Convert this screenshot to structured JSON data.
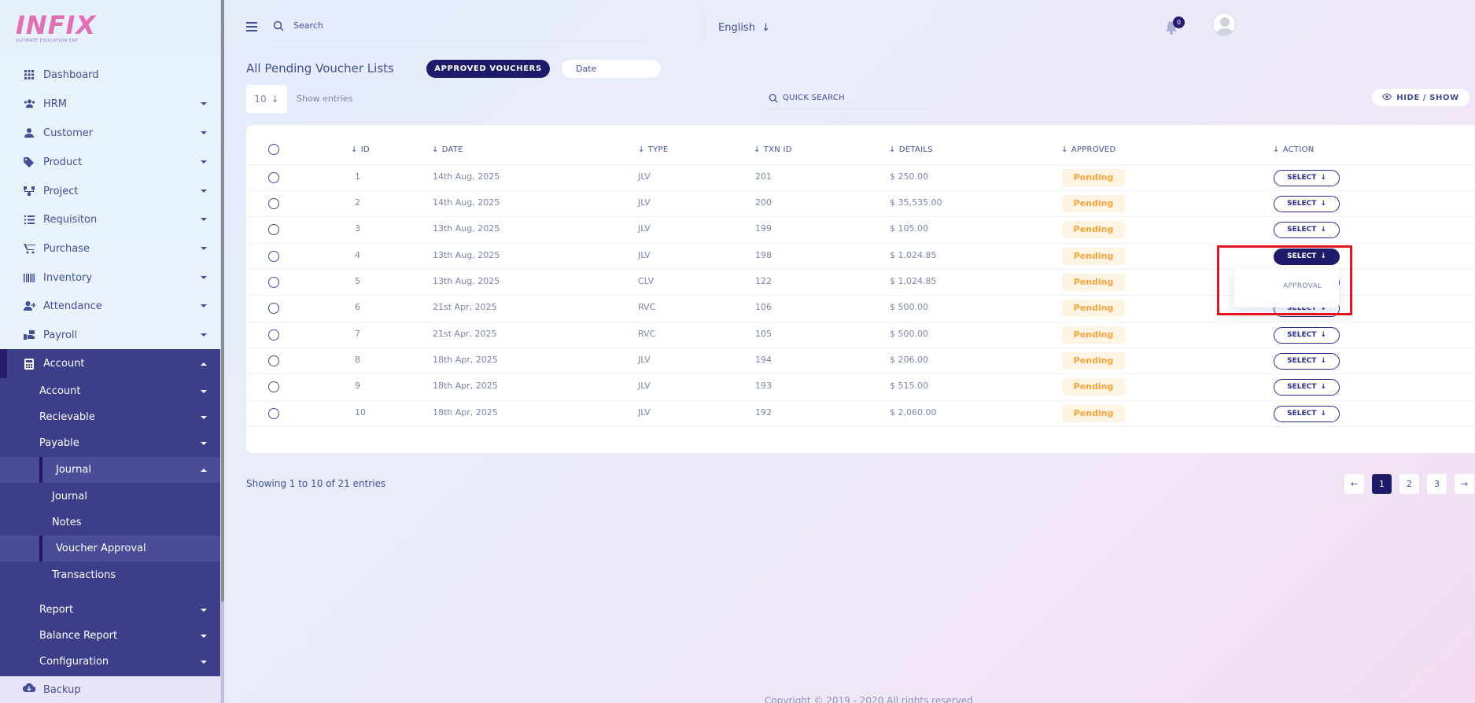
{
  "sidebar": {
    "logo": "INFIX",
    "logo_sub": "ULTIMATE EDUCATION ERP",
    "items": [
      {
        "label": "Dashboard",
        "icon": "grid-icon"
      },
      {
        "label": "HRM",
        "icon": "users-icon"
      },
      {
        "label": "Customer",
        "icon": "user-icon"
      },
      {
        "label": "Product",
        "icon": "tag-icon"
      },
      {
        "label": "Project",
        "icon": "nodes-icon"
      },
      {
        "label": "Requisiton",
        "icon": "list-icon"
      },
      {
        "label": "Purchase",
        "icon": "cart-icon"
      },
      {
        "label": "Inventory",
        "icon": "barcode-icon"
      },
      {
        "label": "Attendance",
        "icon": "user-plus-icon"
      },
      {
        "label": "Payroll",
        "icon": "money-icon"
      },
      {
        "label": "Account",
        "icon": "calculator-icon"
      }
    ],
    "account_sub": [
      {
        "label": "Account"
      },
      {
        "label": "Recievable"
      },
      {
        "label": "Payable"
      },
      {
        "label": "Journal"
      },
      {
        "label": "Journal"
      },
      {
        "label": "Notes"
      },
      {
        "label": "Voucher Approval"
      },
      {
        "label": "Transactions"
      },
      {
        "label": "Report"
      },
      {
        "label": "Balance Report"
      },
      {
        "label": "Configuration"
      }
    ],
    "backup": "Backup"
  },
  "header": {
    "search_placeholder": "Search",
    "language": "English",
    "notification_count": "0"
  },
  "page": {
    "title": "All Pending Voucher Lists",
    "approved_button": "APPROVED VOUCHERS",
    "date_placeholder": "Date",
    "entries_value": "10",
    "entries_label": "Show entries",
    "quick_search": "QUICK SEARCH",
    "hide_show": "HIDE / SHOW"
  },
  "table": {
    "columns": [
      "ID",
      "DATE",
      "TYPE",
      "TXN ID",
      "DETAILS",
      "APPROVED",
      "ACTION"
    ],
    "rows": [
      {
        "id": "1",
        "date": "14th Aug, 2025",
        "type": "JLV",
        "txn": "201",
        "details": "$ 250.00",
        "approved": "Pending",
        "action": "SELECT"
      },
      {
        "id": "2",
        "date": "14th Aug, 2025",
        "type": "JLV",
        "txn": "200",
        "details": "$ 35,535.00",
        "approved": "Pending",
        "action": "SELECT"
      },
      {
        "id": "3",
        "date": "13th Aug, 2025",
        "type": "JLV",
        "txn": "199",
        "details": "$ 105.00",
        "approved": "Pending",
        "action": "SELECT"
      },
      {
        "id": "4",
        "date": "13th Aug, 2025",
        "type": "JLV",
        "txn": "198",
        "details": "$ 1,024.85",
        "approved": "Pending",
        "action": "SELECT"
      },
      {
        "id": "5",
        "date": "13th Aug, 2025",
        "type": "CLV",
        "txn": "122",
        "details": "$ 1,024.85",
        "approved": "Pending",
        "action": "SELECT"
      },
      {
        "id": "6",
        "date": "21st Apr, 2025",
        "type": "RVC",
        "txn": "106",
        "details": "$ 500.00",
        "approved": "Pending",
        "action": "SELECT"
      },
      {
        "id": "7",
        "date": "21st Apr, 2025",
        "type": "RVC",
        "txn": "105",
        "details": "$ 500.00",
        "approved": "Pending",
        "action": "SELECT"
      },
      {
        "id": "8",
        "date": "18th Apr, 2025",
        "type": "JLV",
        "txn": "194",
        "details": "$ 206.00",
        "approved": "Pending",
        "action": "SELECT"
      },
      {
        "id": "9",
        "date": "18th Apr, 2025",
        "type": "JLV",
        "txn": "193",
        "details": "$ 515.00",
        "approved": "Pending",
        "action": "SELECT"
      },
      {
        "id": "10",
        "date": "18th Apr, 2025",
        "type": "JLV",
        "txn": "192",
        "details": "$ 2,060.00",
        "approved": "Pending",
        "action": "SELECT"
      }
    ],
    "dropdown_item": "APPROVAL"
  },
  "footer": {
    "showing": "Showing 1 to 10 of 21 entries",
    "pages": [
      "1",
      "2",
      "3"
    ],
    "copyright": "Copyright © 2019 - 2020 All rights reserved"
  },
  "colors": {
    "primary": "#1f1b6b",
    "sidebar_active": "#3c3e8a",
    "pending_text": "#f8a43c",
    "pending_bg": "#fdf4e4",
    "highlight": "#e5131b"
  }
}
